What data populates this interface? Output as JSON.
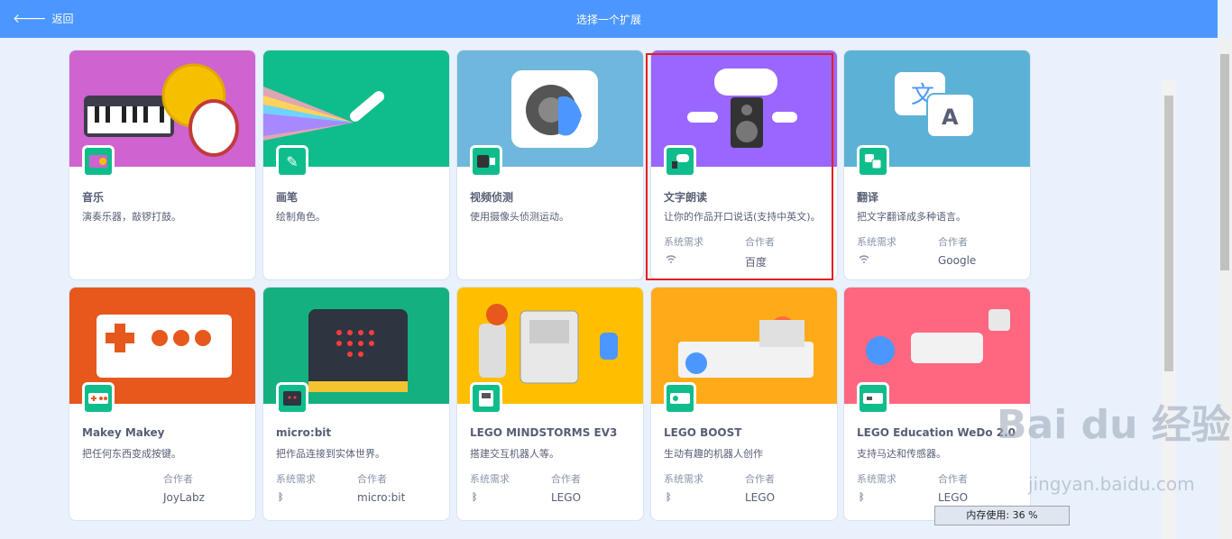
{
  "header": {
    "back_label": "返回",
    "title": "选择一个扩展"
  },
  "labels": {
    "sys_req": "系统需求",
    "collab": "合作者"
  },
  "cards": [
    {
      "name": "音乐",
      "desc": "演奏乐器，敲锣打鼓。",
      "bg": "#cf63cf",
      "badge": "#0fbd8c"
    },
    {
      "name": "画笔",
      "desc": "绘制角色。",
      "bg": "#0fbd8c",
      "badge": "#0fbd8c"
    },
    {
      "name": "视频侦测",
      "desc": "使用摄像头侦测运动。",
      "bg": "#6fb7dd",
      "badge": "#0fbd8c"
    },
    {
      "name": "文字朗读",
      "desc": "让你的作品开口说话(支持中英文)。",
      "bg": "#9966ff",
      "badge": "#0fbd8c",
      "collab": "百度"
    },
    {
      "name": "翻译",
      "desc": "把文字翻译成多种语言。",
      "bg": "#5cb1d6",
      "badge": "#0fbd8c",
      "collab": "Google"
    },
    {
      "name": "Makey Makey",
      "desc": "把任何东西变成按键。",
      "bg": "#e6581c",
      "badge": "#0fbd8c",
      "collab": "JoyLabz"
    },
    {
      "name": "micro:bit",
      "desc": "把作品连接到实体世界。",
      "bg": "#15b080",
      "badge": "#0fbd8c",
      "collab": "micro:bit"
    },
    {
      "name": "LEGO MINDSTORMS EV3",
      "desc": "搭建交互机器人等。",
      "bg": "#ffbf00",
      "badge": "#0fbd8c",
      "collab": "LEGO"
    },
    {
      "name": "LEGO BOOST",
      "desc": "生动有趣的机器人创作",
      "bg": "#ffab19",
      "badge": "#0fbd8c",
      "collab": "LEGO"
    },
    {
      "name": "LEGO Education WeDo 2.0",
      "desc": "支持马达和传感器。",
      "bg": "#ff6680",
      "badge": "#0fbd8c",
      "collab": "LEGO"
    }
  ],
  "status": {
    "memory": "内存使用: 36 %"
  },
  "watermark": {
    "brand": "Bai du 经验",
    "url": "jingyan.baidu.com"
  },
  "icons": {
    "back": "arrow-left-icon",
    "wifi": "wifi-icon",
    "bluetooth": "bluetooth-icon"
  }
}
